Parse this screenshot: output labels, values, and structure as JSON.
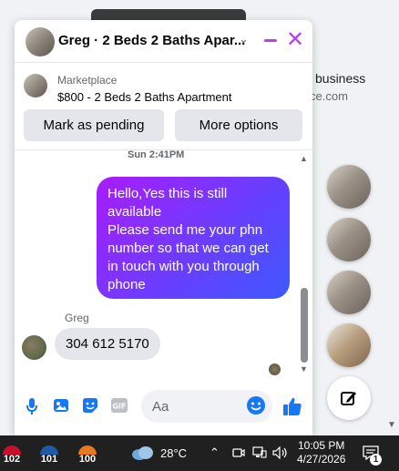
{
  "background": {
    "business_text": "business",
    "url_text": "ce.com"
  },
  "chat": {
    "title": "Greg · 2 Beds 2 Baths Apar...",
    "listing_source": "Marketplace",
    "listing_title": "$800 - 2 Beds 2 Baths Apartment",
    "mark_pending_label": "Mark as pending",
    "more_options_label": "More options",
    "timestamp": "Sun 2:41PM",
    "outgoing_message": "Hello,Yes this is still available\nPlease send me your phn number so that we can get in touch with you through phone",
    "sender_name": "Greg",
    "incoming_message": "304 612 5170",
    "input_placeholder": "Aa"
  },
  "taskbar": {
    "apps": [
      {
        "label": "102",
        "color": "#c8102e"
      },
      {
        "label": "101",
        "color": "#1f5aa6"
      },
      {
        "label": "100",
        "color": "#e87722"
      }
    ],
    "temperature": "28°C",
    "time": "10:05 PM",
    "date": "4/27/2026",
    "notification_count": "1"
  },
  "colors": {
    "accent": "#bc3cf2",
    "bubble_gradient_start": "#a91cff",
    "bubble_gradient_end": "#3d59ff",
    "messenger_blue": "#1877f2"
  }
}
